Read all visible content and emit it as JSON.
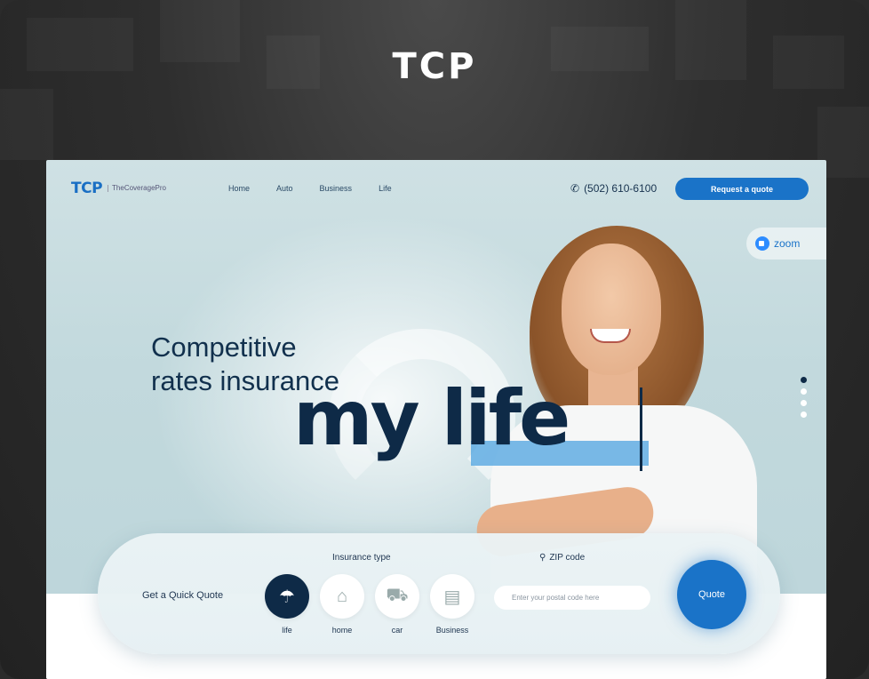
{
  "brand": {
    "title": "TCP"
  },
  "site": {
    "logo": {
      "mark": "TCP",
      "text": "TheCoveragePro"
    },
    "nav": [
      "Home",
      "Auto",
      "Business",
      "Life"
    ],
    "phone": "(502) 610-6100",
    "request_button": "Request a quote",
    "zoom_label": "zoom",
    "hero": {
      "headline_line1": "Competitive",
      "headline_line2": "rates insurance",
      "big_text": "my life"
    },
    "quick_quote": {
      "label": "Get a Quick Quote",
      "insurance_type_label": "Insurance type",
      "types": [
        {
          "label": "life",
          "icon": "umbrella-icon",
          "selected": true
        },
        {
          "label": "home",
          "icon": "home-icon",
          "selected": false
        },
        {
          "label": "car",
          "icon": "car-icon",
          "selected": false
        },
        {
          "label": "Business",
          "icon": "briefcase-icon",
          "selected": false
        }
      ],
      "zip_label": "ZIP code",
      "zip_placeholder": "Enter your postal code here",
      "quote_button": "Quote"
    },
    "slider": {
      "total": 4,
      "active_index": 0
    },
    "colors": {
      "accent": "#1a73c8",
      "navy": "#0e2a47",
      "highlight": "#4ea3e0"
    }
  }
}
